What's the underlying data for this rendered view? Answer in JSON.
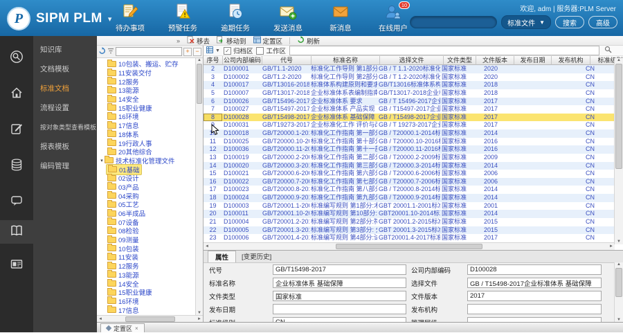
{
  "topbar": {
    "logo_text": "SIPM PLM",
    "welcome_text": "欢迎, adm | 服务器:PLM Server",
    "actions": [
      {
        "icon": "todo-icon",
        "label": "待办事项"
      },
      {
        "icon": "alert-task-icon",
        "label": "预警任务"
      },
      {
        "icon": "overdue-task-icon",
        "label": "逾期任务"
      },
      {
        "icon": "send-message-icon",
        "label": "发送消息"
      },
      {
        "icon": "new-message-icon",
        "label": "新消息"
      },
      {
        "icon": "online-users-icon",
        "label": "在线用户",
        "badge": "10"
      }
    ],
    "search": {
      "value": "",
      "category": "标准文件",
      "search_label": "搜索",
      "advanced_label": "高级"
    }
  },
  "icon_rail": [
    {
      "icon": "search-badge-icon",
      "active": false
    },
    {
      "icon": "home-icon",
      "active": false
    },
    {
      "icon": "edit-icon",
      "active": false
    },
    {
      "icon": "database-icon",
      "active": false
    },
    {
      "icon": "chat-icon",
      "active": false
    },
    {
      "icon": "book-icon",
      "active": true
    },
    {
      "icon": "card-icon",
      "active": false
    }
  ],
  "side_menu": [
    {
      "label": "知识库",
      "active": false
    },
    {
      "label": "文档模板",
      "active": false
    },
    {
      "label": "标准文档",
      "active": true
    },
    {
      "label": "流程设置",
      "active": false
    },
    {
      "label": "按对象类型查看模板",
      "active": false
    },
    {
      "label": "报表模板",
      "active": false
    },
    {
      "label": "编码管理",
      "active": false
    }
  ],
  "tree": {
    "filter_value": "",
    "expand_all_label": "+",
    "collapse_all_label": "−",
    "items": [
      {
        "label": "10包装、搬运、贮存",
        "level": 1,
        "selected": false,
        "expanded": false
      },
      {
        "label": "11安装交付",
        "level": 1,
        "selected": false,
        "expanded": false
      },
      {
        "label": "12服务",
        "level": 1,
        "selected": false,
        "expanded": false
      },
      {
        "label": "13能源",
        "level": 1,
        "selected": false,
        "expanded": false
      },
      {
        "label": "14安全",
        "level": 1,
        "selected": false,
        "expanded": false
      },
      {
        "label": "15职业健康",
        "level": 1,
        "selected": false,
        "expanded": false
      },
      {
        "label": "16环境",
        "level": 1,
        "selected": false,
        "expanded": false
      },
      {
        "label": "17信息",
        "level": 1,
        "selected": false,
        "expanded": false
      },
      {
        "label": "18体系",
        "level": 1,
        "selected": false,
        "expanded": false
      },
      {
        "label": "19行政人事",
        "level": 1,
        "selected": false,
        "expanded": false
      },
      {
        "label": "20其他综合",
        "level": 1,
        "selected": false,
        "expanded": false
      },
      {
        "label": "技术标准化管理文件",
        "level": 0,
        "selected": false,
        "expanded": true
      },
      {
        "label": "01基础",
        "level": 1,
        "selected": true,
        "expanded": false
      },
      {
        "label": "02设计",
        "level": 1,
        "selected": false,
        "expanded": false
      },
      {
        "label": "03产品",
        "level": 1,
        "selected": false,
        "expanded": false
      },
      {
        "label": "04采购",
        "level": 1,
        "selected": false,
        "expanded": false
      },
      {
        "label": "05工艺",
        "level": 1,
        "selected": false,
        "expanded": false
      },
      {
        "label": "06半成品",
        "level": 1,
        "selected": false,
        "expanded": false
      },
      {
        "label": "07设备",
        "level": 1,
        "selected": false,
        "expanded": false
      },
      {
        "label": "08检验",
        "level": 1,
        "selected": false,
        "expanded": false
      },
      {
        "label": "09测量",
        "level": 1,
        "selected": false,
        "expanded": false
      },
      {
        "label": "10包装",
        "level": 1,
        "selected": false,
        "expanded": false
      },
      {
        "label": "11安装",
        "level": 1,
        "selected": false,
        "expanded": false
      },
      {
        "label": "12服务",
        "level": 1,
        "selected": false,
        "expanded": false
      },
      {
        "label": "13能源",
        "level": 1,
        "selected": false,
        "expanded": false
      },
      {
        "label": "14安全",
        "level": 1,
        "selected": false,
        "expanded": false
      },
      {
        "label": "15职业健康",
        "level": 1,
        "selected": false,
        "expanded": false
      },
      {
        "label": "16环境",
        "level": 1,
        "selected": false,
        "expanded": false
      },
      {
        "label": "17信息",
        "level": 1,
        "selected": false,
        "expanded": false
      }
    ]
  },
  "toolbar": {
    "collapse_glyph": "»",
    "remove_label": "移去",
    "move_label": "移动到",
    "zone_label": "定置区",
    "refresh_label": "刷新",
    "archive_checkbox": "归档区",
    "archive_checked": "✓",
    "work_checkbox": "工作区",
    "filter_value": ""
  },
  "table": {
    "columns": [
      "序号",
      "公司内部编码",
      "代号",
      "标准名称",
      "选择文件",
      "文件类型",
      "文件版本",
      "发布日期",
      "发布机构",
      "标准级别"
    ],
    "selected_seq": "8",
    "rows": [
      [
        "2",
        "D100001",
        "GB/T1.1-2020",
        "标准化工作导则 第1部分：..",
        "GB / T 1.1-2020标准化工作..",
        "国家标准",
        "2020",
        "",
        "",
        "CN"
      ],
      [
        "3",
        "D100002",
        "GB/T1.2-2020",
        "标准化工作导则 第2部分：..",
        "GB / T 1.2-2020标准化工作..",
        "国家标准",
        "2020",
        "",
        "",
        "CN"
      ],
      [
        "4",
        "D100017",
        "GB/T13016-2018",
        "标准体系构建原则和要求",
        "GB/T13016标准体系构建..",
        "国家标准",
        "2018",
        "",
        "",
        "CN"
      ],
      [
        "5",
        "D100007",
        "GB/T13017-2018",
        "企业标准体系表编制指南",
        "GB/T13017-2018企业标准..",
        "国家标准",
        "2018",
        "",
        "",
        "CN"
      ],
      [
        "6",
        "D100026",
        "GB/T15496-2017",
        "企业标准体系 要求",
        "GB / T 15496-2017企业标..",
        "国家标准",
        "2017",
        "",
        "",
        "CN"
      ],
      [
        "7",
        "D100027",
        "GB/T15497-2017",
        "企业标准体系 产品实现",
        "GB / T15497-2017企业标..",
        "国家标准",
        "2017",
        "",
        "",
        "CN"
      ],
      [
        "8",
        "D100028",
        "GB/T15498-2017",
        "企业标准体系 基础保障",
        "GB / T15498-2017企业标..",
        "国家标准",
        "2017",
        "",
        "",
        "CN"
      ],
      [
        "9",
        "D100031",
        "GB/T19273-2017",
        "企业标准化工作 评价与改进",
        "GB / T 19273-2017企业标..",
        "国家标准",
        "2017",
        "",
        "",
        "CN"
      ],
      [
        "10",
        "D100018",
        "GB/T20000.1-2014",
        "标准化工作指南 第一部分：..",
        "GB / T20000.1-2014标准..",
        "国家标准",
        "2014",
        "",
        "",
        "CN"
      ],
      [
        "11",
        "D100025",
        "GB/T20000.10-2016",
        "标准化工作指南 第十部分：..",
        "GB / T20000.10-2016标准..",
        "国家标准",
        "2016",
        "",
        "",
        "CN"
      ],
      [
        "12",
        "D100036",
        "GB/T20000.11-2016",
        "标准化工作指南 第十一部分..",
        "GB / T20000.11-2016标准..",
        "国家标准",
        "2016",
        "",
        "",
        "CN"
      ],
      [
        "13",
        "D100019",
        "GB/T20000.2-2009",
        "标准化工作指南 第二部分：..",
        "GB / T20000.2-2009标准..",
        "国家标准",
        "2009",
        "",
        "",
        "CN"
      ],
      [
        "14",
        "D100020",
        "GB/T20000.3-2014",
        "标准化工作指南 第三部分：..",
        "GB / T20000.3-2014标准..",
        "国家标准",
        "2014",
        "",
        "",
        "CN"
      ],
      [
        "15",
        "D100021",
        "GB/T20000.6-2006",
        "标准化工作指南 第六部分：..",
        "GB / T20000.6-2006标准..",
        "国家标准",
        "2006",
        "",
        "",
        "CN"
      ],
      [
        "16",
        "D100022",
        "GB/T20000.7-2006",
        "标准化工作指南 第七部分：..",
        "GB / T20000.7-2006标准..",
        "国家标准",
        "2006",
        "",
        "",
        "CN"
      ],
      [
        "17",
        "D100023",
        "GB/T20000.8-2014",
        "标准化工作指南 第八部分：..",
        "GB / T20000.8-2014标准..",
        "国家标准",
        "2014",
        "",
        "",
        "CN"
      ],
      [
        "18",
        "D100024",
        "GB/T20000.9-2014",
        "标准化工作指南 第九部分：..",
        "GB / T20000.9-2014标准..",
        "国家标准",
        "2014",
        "",
        "",
        "CN"
      ],
      [
        "19",
        "D100003",
        "GB/T20001.1-2001",
        "标准编写规则 第1部分:术语",
        "GBT 20001.1-2001标准编..",
        "国家标准",
        "2001",
        "",
        "",
        "CN"
      ],
      [
        "20",
        "D100011",
        "GB/T20001.10-2014",
        "标准编写规则 第10部分:产品..",
        "GBT20001.10-2014标准编..",
        "国家标准",
        "2014",
        "",
        "",
        "CN"
      ],
      [
        "21",
        "D100004",
        "GB/T20001.2-2015",
        "标准编写规则 第2部分:符号..",
        "GBT 20001.2-2015标准编..",
        "国家标准",
        "2015",
        "",
        "",
        "CN"
      ],
      [
        "22",
        "D100005",
        "GB/T20001.3-2015",
        "标准编写规则 第3部分: 分类..",
        "GBT 20001.3-2015标准编..",
        "国家标准",
        "2015",
        "",
        "",
        "CN"
      ],
      [
        "23",
        "D100006",
        "GB/T20001.4-2017",
        "标准编写规则 第4部分:试验..",
        "GBT20001.4-2017标准..",
        "国家标准",
        "2017",
        "",
        "",
        "CN"
      ]
    ]
  },
  "properties": {
    "active_tab": "属性",
    "history_tab": "[变更历史]",
    "rows": [
      {
        "l_label": "代号",
        "l_value": "GB/T15498-2017",
        "r_label": "公司内部编码",
        "r_value": "D100028"
      },
      {
        "l_label": "标准名称",
        "l_value": "企业标准体系 基础保障",
        "r_label": "选择文件",
        "r_value": "GB / T15498-2017企业标准体系 基础保障"
      },
      {
        "l_label": "文件类型",
        "l_value": "国家标准",
        "r_label": "文件版本",
        "r_value": "2017"
      },
      {
        "l_label": "发布日期",
        "l_value": "",
        "r_label": "发布机构",
        "r_value": ""
      },
      {
        "l_label": "标准级别",
        "l_value": "CN",
        "r_label": "管理层级",
        "r_value": ""
      }
    ]
  },
  "status": {
    "tab_label": "定置区"
  }
}
